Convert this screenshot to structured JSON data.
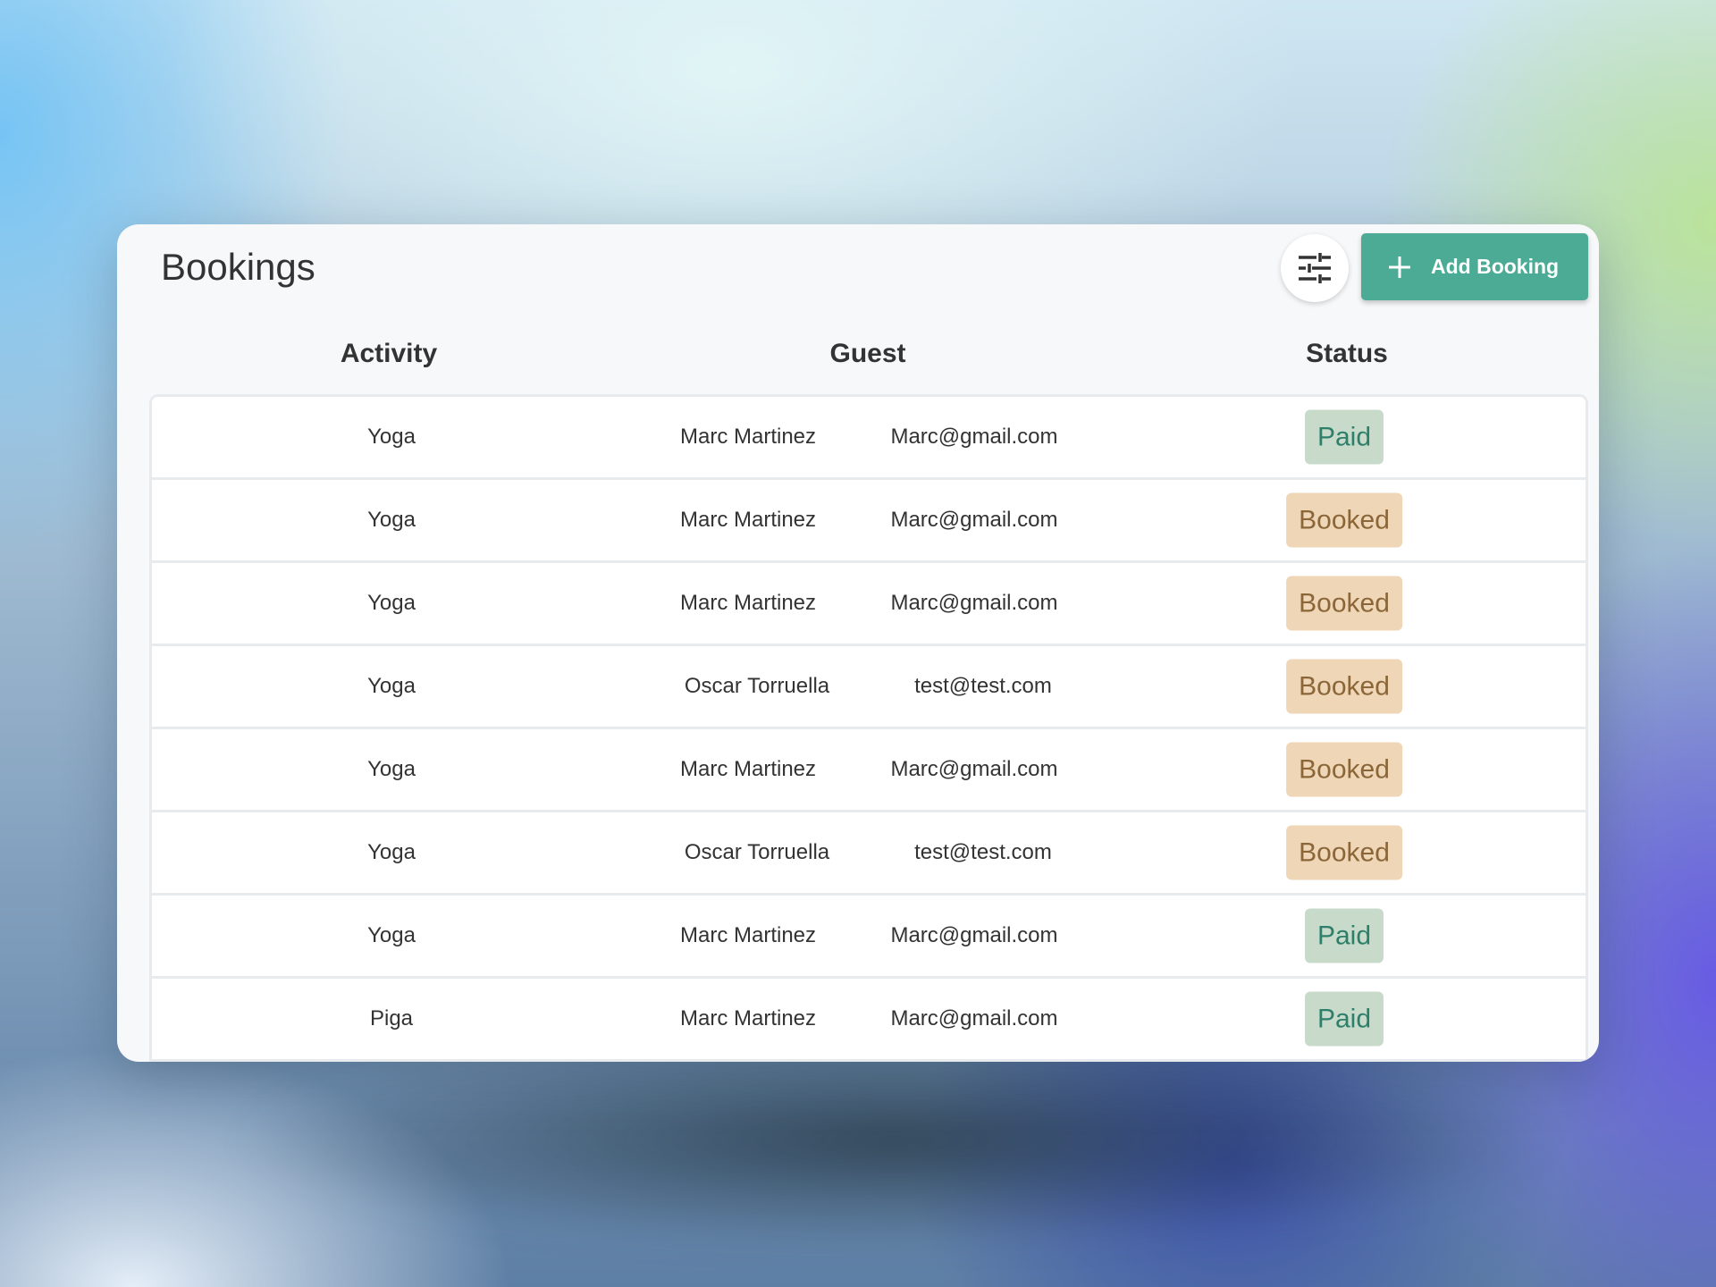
{
  "header": {
    "title": "Bookings",
    "add_button_label": "Add Booking",
    "filter_icon": "sliders-icon",
    "add_icon": "plus-icon"
  },
  "table": {
    "columns": [
      "Activity",
      "Guest",
      "Status"
    ],
    "rows": [
      {
        "activity": "Yoga",
        "name": "Marc Martinez",
        "email": "Marc@gmail.com",
        "status": "Paid"
      },
      {
        "activity": "Yoga",
        "name": "Marc Martinez",
        "email": "Marc@gmail.com",
        "status": "Booked"
      },
      {
        "activity": "Yoga",
        "name": "Marc Martinez",
        "email": "Marc@gmail.com",
        "status": "Booked"
      },
      {
        "activity": "Yoga",
        "name": "Oscar Torruella",
        "email": "test@test.com",
        "status": "Booked"
      },
      {
        "activity": "Yoga",
        "name": "Marc Martinez",
        "email": "Marc@gmail.com",
        "status": "Booked"
      },
      {
        "activity": "Yoga",
        "name": "Oscar Torruella",
        "email": "test@test.com",
        "status": "Booked"
      },
      {
        "activity": "Yoga",
        "name": "Marc Martinez",
        "email": "Marc@gmail.com",
        "status": "Paid"
      },
      {
        "activity": "Piga",
        "name": "Marc Martinez",
        "email": "Marc@gmail.com",
        "status": "Paid"
      }
    ]
  },
  "colors": {
    "accent": "#4bab94",
    "paid_bg": "#c8dbcb",
    "paid_text": "#2e7f6a",
    "booked_bg": "#efd6b7",
    "booked_text": "#8a6638"
  }
}
